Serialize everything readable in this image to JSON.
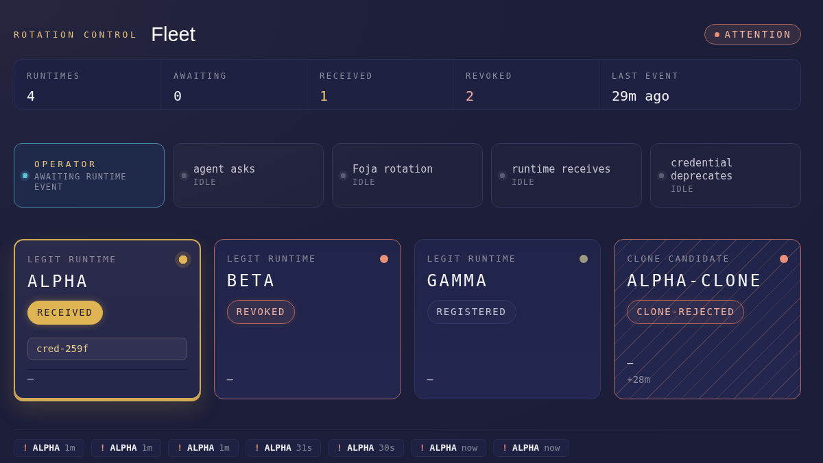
{
  "header": {
    "eyebrow": "ROTATION CONTROL",
    "title": "Fleet",
    "alert": {
      "label": "ATTENTION",
      "color": "#e8907a"
    }
  },
  "stats": [
    {
      "label": "RUNTIMES",
      "value": "4",
      "color": "#f4f4f8"
    },
    {
      "label": "AWAITING",
      "value": "0",
      "color": "#f4f4f8"
    },
    {
      "label": "RECEIVED",
      "value": "1",
      "color": "#ecc67a"
    },
    {
      "label": "REVOKED",
      "value": "2",
      "color": "#f0ab9a"
    },
    {
      "label": "LAST EVENT",
      "value": "29m ago",
      "color": "#f4f4f8"
    }
  ],
  "pipeline": [
    {
      "title": "OPERATOR",
      "status": "AWAITING RUNTIME EVENT",
      "active": true
    },
    {
      "title": "agent asks",
      "status": "IDLE",
      "active": false
    },
    {
      "title": "Foja rotation",
      "status": "IDLE",
      "active": false
    },
    {
      "title": "runtime receives",
      "status": "IDLE",
      "active": false
    },
    {
      "title": "credential deprecates",
      "status": "IDLE",
      "active": false
    }
  ],
  "runtimes": [
    {
      "kind": "legit",
      "role": "LEGIT RUNTIME",
      "name": "ALPHA",
      "selected": true,
      "color": "#e2b553",
      "status": {
        "label": "RECEIVED",
        "kind": "received"
      },
      "credential": "cred-259f",
      "footer": [
        "–"
      ]
    },
    {
      "kind": "legit",
      "role": "LEGIT RUNTIME",
      "name": "BETA",
      "selected": false,
      "color": "#ec8f7a",
      "status": {
        "label": "REVOKED",
        "kind": "revoked"
      },
      "footer": [
        "–"
      ]
    },
    {
      "kind": "legit",
      "role": "LEGIT RUNTIME",
      "name": "GAMMA",
      "selected": false,
      "color": "#9c9a80",
      "status": {
        "label": "REGISTERED",
        "kind": "registered"
      },
      "footer": [
        "–"
      ]
    },
    {
      "kind": "clone",
      "role": "CLONE CANDIDATE",
      "name": "ALPHA-CLONE",
      "selected": false,
      "color": "#ec8f7a",
      "status": {
        "label": "CLONE-REJECTED",
        "kind": "rejected"
      },
      "footer": [
        "–",
        "+28m"
      ]
    }
  ],
  "events": [
    {
      "mark": "!",
      "runtime": "ALPHA",
      "time": "1m"
    },
    {
      "mark": "!",
      "runtime": "ALPHA",
      "time": "1m"
    },
    {
      "mark": "!",
      "runtime": "ALPHA",
      "time": "1m"
    },
    {
      "mark": "!",
      "runtime": "ALPHA",
      "time": "31s"
    },
    {
      "mark": "!",
      "runtime": "ALPHA",
      "time": "30s"
    },
    {
      "mark": "!",
      "runtime": "ALPHA",
      "time": "now"
    },
    {
      "mark": "!",
      "runtime": "ALPHA",
      "time": "now"
    }
  ]
}
